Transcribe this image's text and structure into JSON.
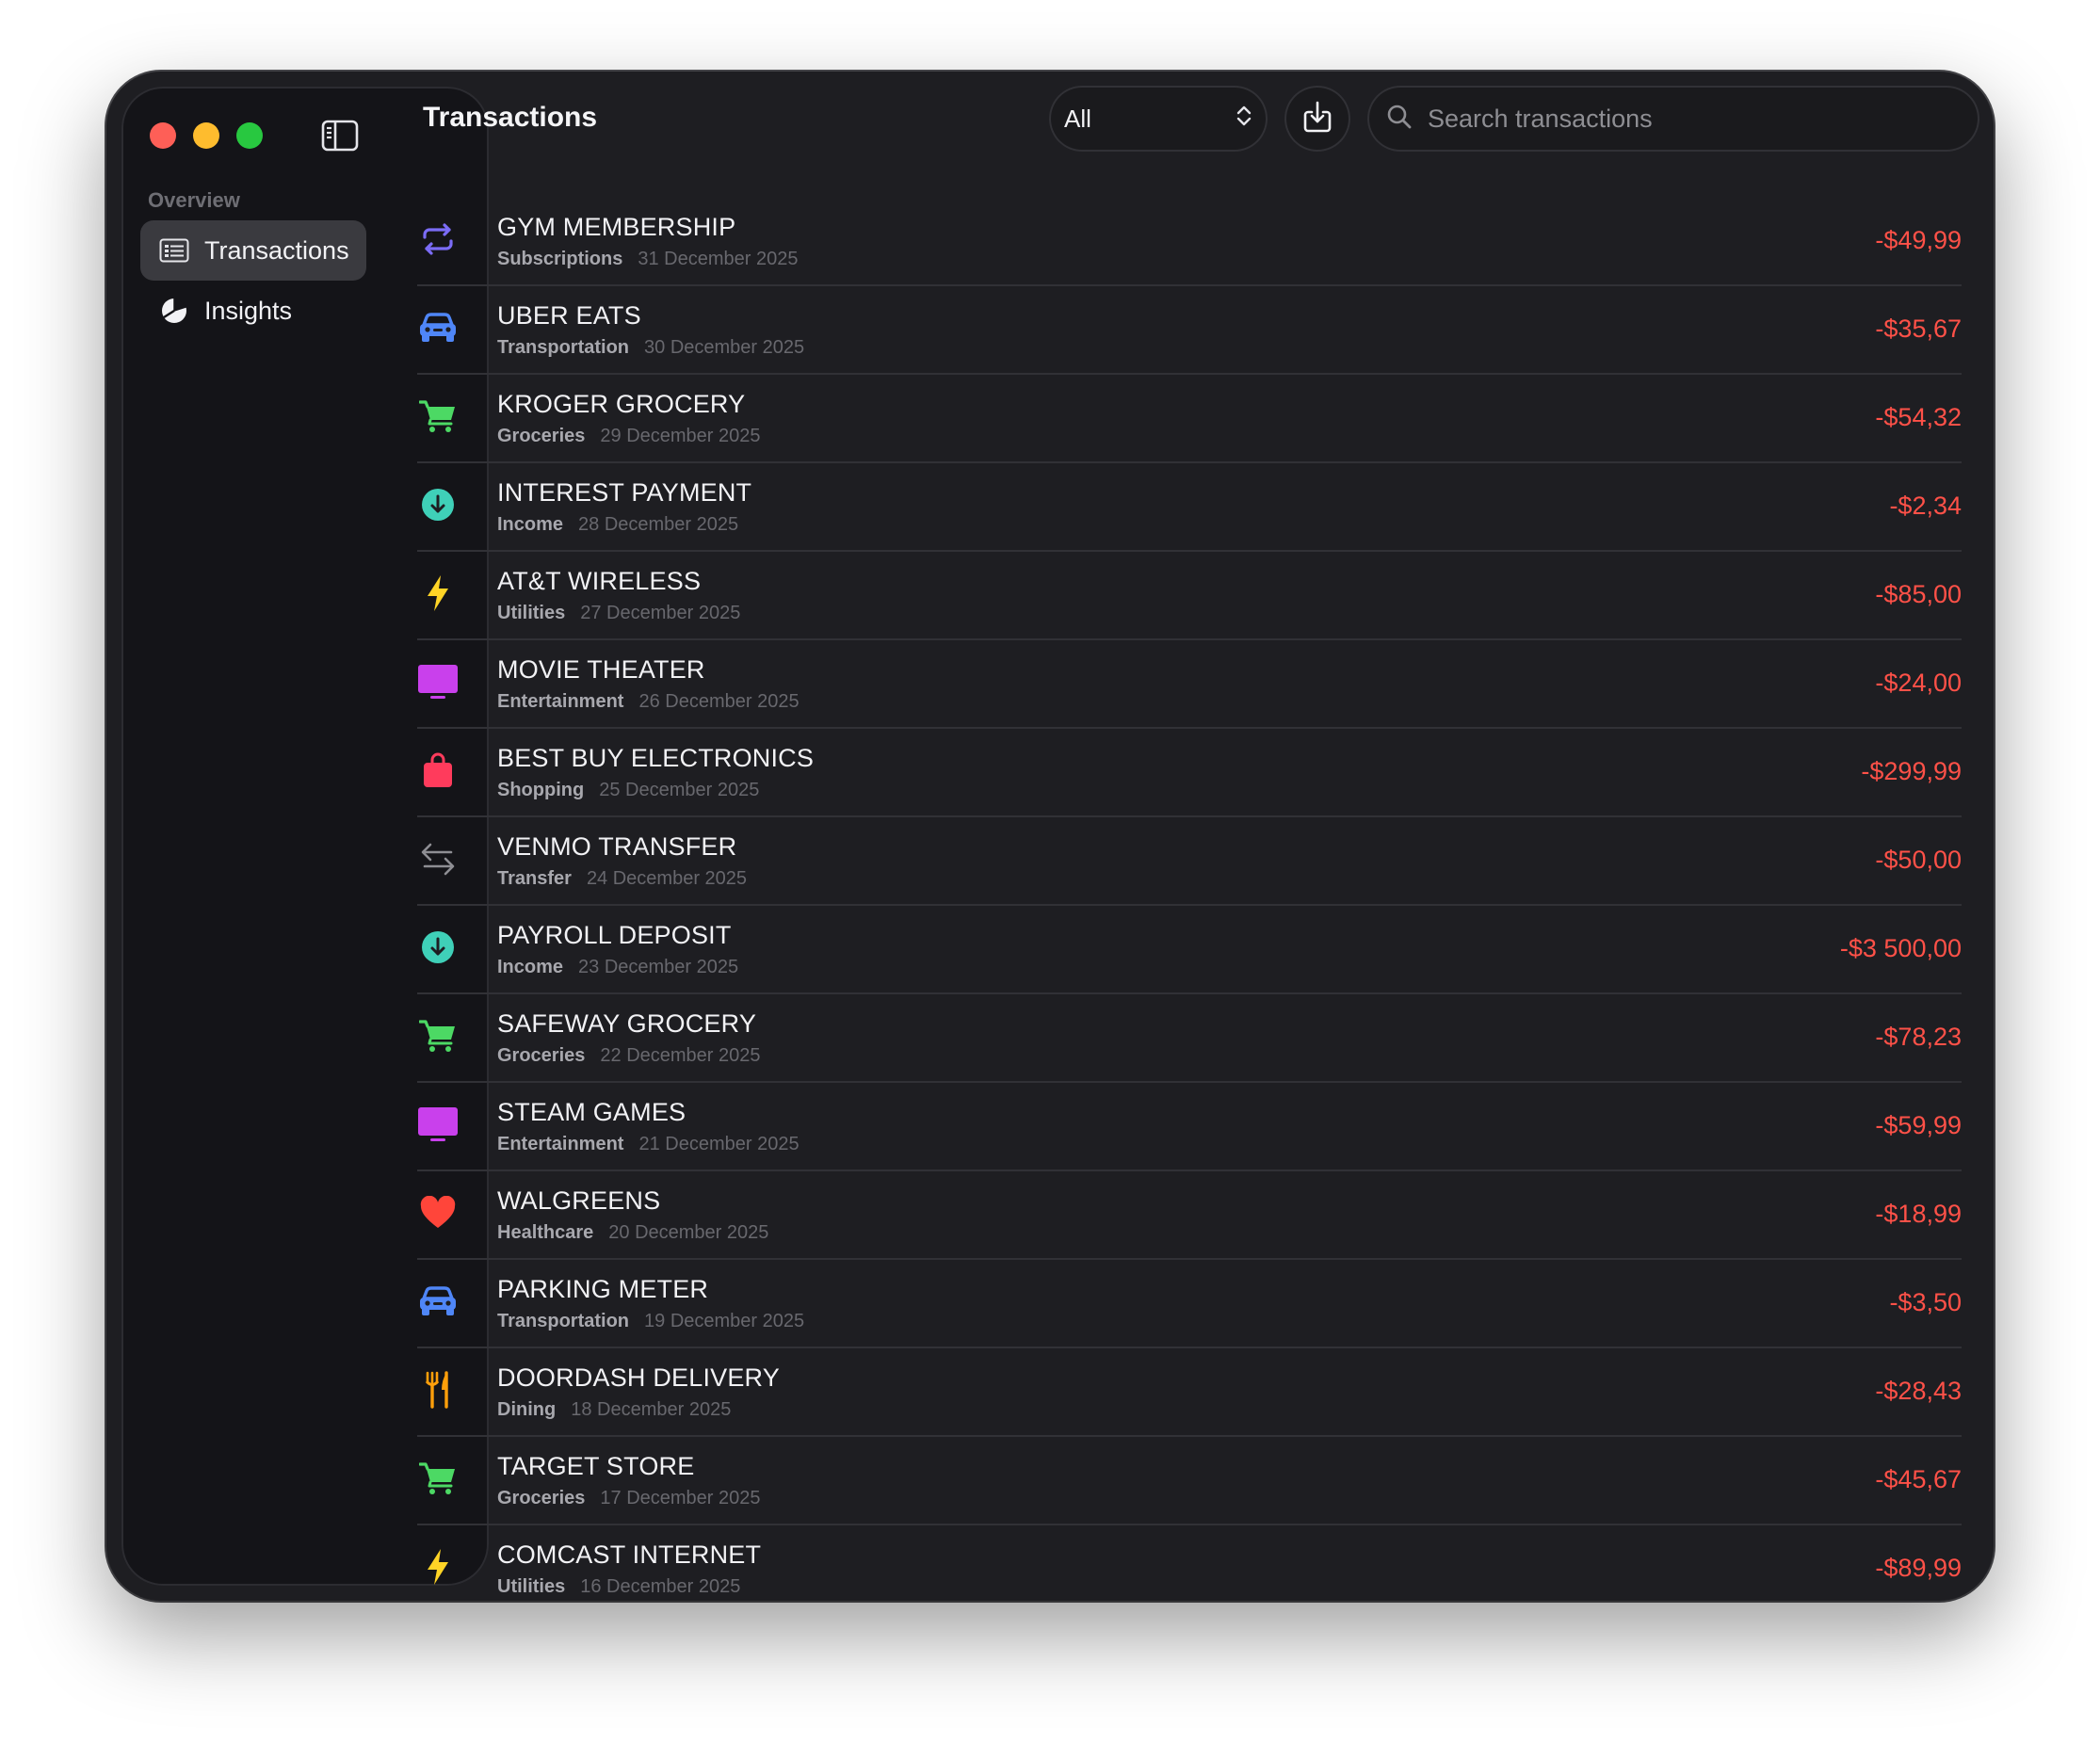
{
  "window": {
    "title": "Transactions"
  },
  "sidebar": {
    "section_label": "Overview",
    "items": [
      {
        "label": "Transactions",
        "icon": "list-icon",
        "active": true
      },
      {
        "label": "Insights",
        "icon": "pie-chart-icon",
        "active": false
      }
    ]
  },
  "toolbar": {
    "filter_value": "All",
    "export_icon": "download-icon",
    "search_placeholder": "Search transactions"
  },
  "colors": {
    "negative_amount": "#ff5148",
    "accent_blue": "#4f86f7",
    "accent_green": "#4cd964"
  },
  "transactions": [
    {
      "name": "GYM MEMBERSHIP",
      "category": "Subscriptions",
      "date": "31 December 2025",
      "amount": "-$49,99",
      "icon": "repeat-icon"
    },
    {
      "name": "UBER EATS",
      "category": "Transportation",
      "date": "30 December 2025",
      "amount": "-$35,67",
      "icon": "car-icon"
    },
    {
      "name": "KROGER GROCERY",
      "category": "Groceries",
      "date": "29 December 2025",
      "amount": "-$54,32",
      "icon": "cart-icon"
    },
    {
      "name": "INTEREST PAYMENT",
      "category": "Income",
      "date": "28 December 2025",
      "amount": "-$2,34",
      "icon": "arrow-down-circle-icon"
    },
    {
      "name": "AT&T WIRELESS",
      "category": "Utilities",
      "date": "27 December 2025",
      "amount": "-$85,00",
      "icon": "bolt-icon"
    },
    {
      "name": "MOVIE THEATER",
      "category": "Entertainment",
      "date": "26 December 2025",
      "amount": "-$24,00",
      "icon": "tv-icon"
    },
    {
      "name": "BEST BUY ELECTRONICS",
      "category": "Shopping",
      "date": "25 December 2025",
      "amount": "-$299,99",
      "icon": "bag-icon"
    },
    {
      "name": "VENMO TRANSFER",
      "category": "Transfer",
      "date": "24 December 2025",
      "amount": "-$50,00",
      "icon": "transfer-arrows-icon"
    },
    {
      "name": "PAYROLL DEPOSIT",
      "category": "Income",
      "date": "23 December 2025",
      "amount": "-$3 500,00",
      "icon": "arrow-down-circle-icon"
    },
    {
      "name": "SAFEWAY GROCERY",
      "category": "Groceries",
      "date": "22 December 2025",
      "amount": "-$78,23",
      "icon": "cart-icon"
    },
    {
      "name": "STEAM GAMES",
      "category": "Entertainment",
      "date": "21 December 2025",
      "amount": "-$59,99",
      "icon": "tv-icon"
    },
    {
      "name": "WALGREENS",
      "category": "Healthcare",
      "date": "20 December 2025",
      "amount": "-$18,99",
      "icon": "heart-icon"
    },
    {
      "name": "PARKING METER",
      "category": "Transportation",
      "date": "19 December 2025",
      "amount": "-$3,50",
      "icon": "car-icon"
    },
    {
      "name": "DOORDASH DELIVERY",
      "category": "Dining",
      "date": "18 December 2025",
      "amount": "-$28,43",
      "icon": "fork-knife-icon"
    },
    {
      "name": "TARGET STORE",
      "category": "Groceries",
      "date": "17 December 2025",
      "amount": "-$45,67",
      "icon": "cart-icon"
    },
    {
      "name": "COMCAST INTERNET",
      "category": "Utilities",
      "date": "16 December 2025",
      "amount": "-$89,99",
      "icon": "bolt-icon"
    }
  ]
}
